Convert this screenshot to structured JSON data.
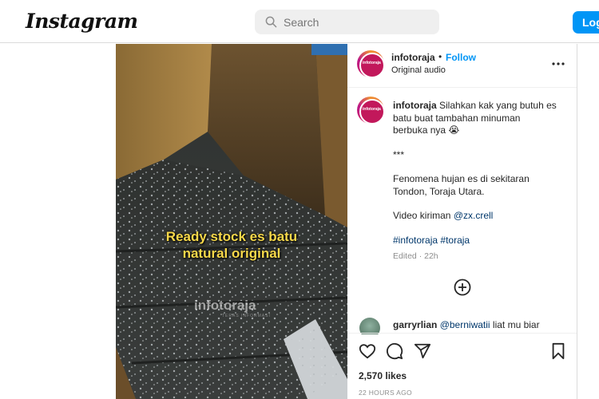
{
  "header": {
    "logo": "Instagram",
    "search_placeholder": "Search",
    "login_label": "Log"
  },
  "video": {
    "overlay_line1": "Ready stock es batu",
    "overlay_line2": "natural original",
    "watermark": "infotoraja",
    "watermark_sub": "TERAS INFORMASI"
  },
  "post": {
    "username": "infotoraja",
    "separator": "•",
    "follow_label": "Follow",
    "audio": "Original audio",
    "avatar_text": "infotoraja",
    "caption": {
      "username": "infotoraja",
      "line1": "Silahkan kak yang butuh es",
      "line2": "batu buat tambahan minuman",
      "line3": "berbuka nya 😭",
      "stars": "***",
      "line4": "Fenomena hujan es di sekitaran",
      "line5": "Tondon, Toraja Utara.",
      "line6_prefix": "Video kiriman ",
      "line6_link": "@zx.crell",
      "tag1": "#infotoraja",
      "tag2": "#toraja",
      "edited": "Edited · 22h"
    },
    "comment": {
      "username": "garryrlian",
      "mention": "@berniwatii",
      "text": " liat mu biar"
    },
    "likes": "2,570 likes",
    "timestamp": "22 HOURS AGO"
  },
  "icons": [
    "search-icon",
    "more-icon",
    "plus-circle-icon",
    "heart-icon",
    "comment-icon",
    "share-icon",
    "bookmark-icon"
  ],
  "colors": {
    "accent": "#0095f6",
    "overlay_text": "#f7d84a"
  }
}
